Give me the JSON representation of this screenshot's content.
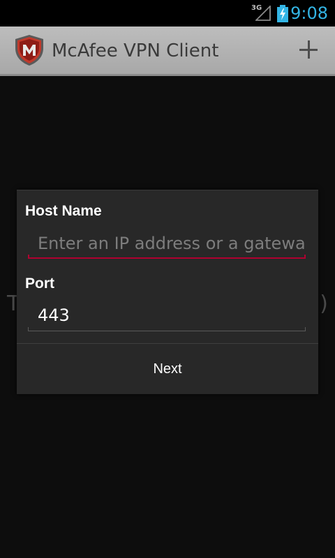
{
  "status_bar": {
    "network_type": "3G",
    "signal_icon": "signal-strength-icon",
    "battery_icon": "battery-charging-icon",
    "time": "9:08",
    "time_color": "#33b5e5"
  },
  "action_bar": {
    "logo_icon": "mcafee-shield-logo",
    "title": "McAfee VPN Client",
    "add_icon": "plus-icon"
  },
  "background": {
    "left_fragment": "T",
    "right_fragment": ")"
  },
  "dialog": {
    "host": {
      "label": "Host Name",
      "placeholder": "Enter an IP address or a gatewa",
      "value": "",
      "focused": true
    },
    "port": {
      "label": "Port",
      "value": "443"
    },
    "next_label": "Next"
  },
  "colors": {
    "accent_focus": "#b00030",
    "action_bar": "#b4b4b4",
    "dialog_bg": "#282828"
  }
}
